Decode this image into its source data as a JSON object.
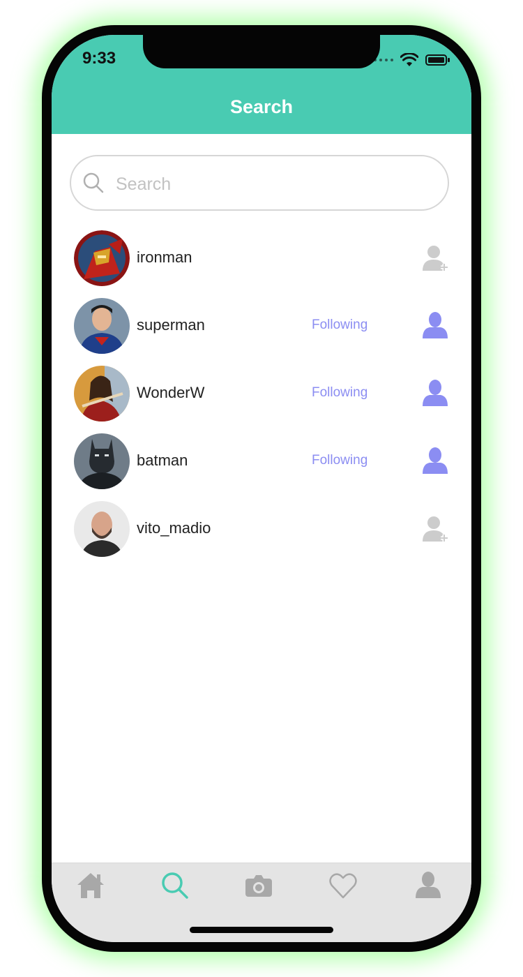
{
  "status_bar": {
    "time": "9:33"
  },
  "header": {
    "title": "Search"
  },
  "search": {
    "placeholder": "Search",
    "value": ""
  },
  "users": [
    {
      "username": "ironman",
      "following_label": "",
      "is_following": false
    },
    {
      "username": "superman",
      "following_label": "Following",
      "is_following": true
    },
    {
      "username": "WonderW",
      "following_label": "Following",
      "is_following": true
    },
    {
      "username": "batman",
      "following_label": "Following",
      "is_following": true
    },
    {
      "username": "vito_madio",
      "following_label": "",
      "is_following": false
    }
  ],
  "tabbar": {
    "items": [
      {
        "icon": "home-icon",
        "active": false
      },
      {
        "icon": "search-icon",
        "active": true
      },
      {
        "icon": "camera-icon",
        "active": false
      },
      {
        "icon": "heart-icon",
        "active": false
      },
      {
        "icon": "profile-icon",
        "active": false
      }
    ]
  },
  "colors": {
    "accent": "#49cbb2",
    "following": "#8b8df2",
    "inactive_icon": "#c9c9c9",
    "tab_inactive": "#a8a8a8",
    "glow": "#7dff6e"
  }
}
